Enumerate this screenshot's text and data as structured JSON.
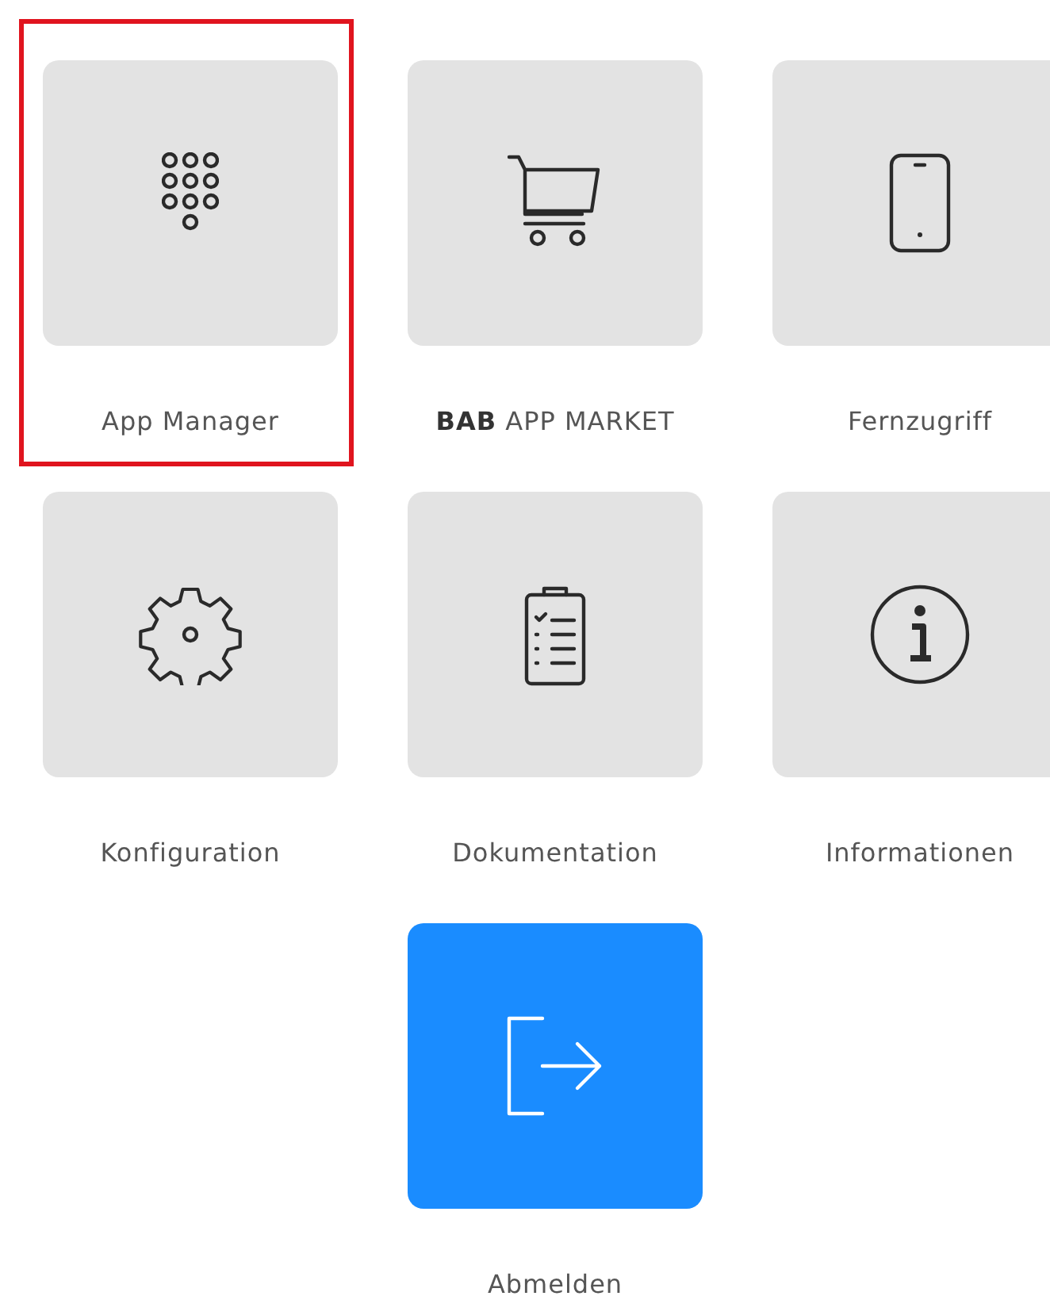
{
  "tiles": [
    {
      "label": "App Manager",
      "kind": "default",
      "highlighted": true
    },
    {
      "label": "**BAB** APP MARKET",
      "kind": "default",
      "highlighted": false
    },
    {
      "label": "Fernzugriff",
      "kind": "default",
      "highlighted": false
    },
    {
      "label": "Konfiguration",
      "kind": "default",
      "highlighted": false
    },
    {
      "label": "Dokumentation",
      "kind": "default",
      "highlighted": false
    },
    {
      "label": "Informationen",
      "kind": "default",
      "highlighted": false
    },
    {
      "label": "Abmelden",
      "kind": "primary",
      "highlighted": false
    }
  ]
}
